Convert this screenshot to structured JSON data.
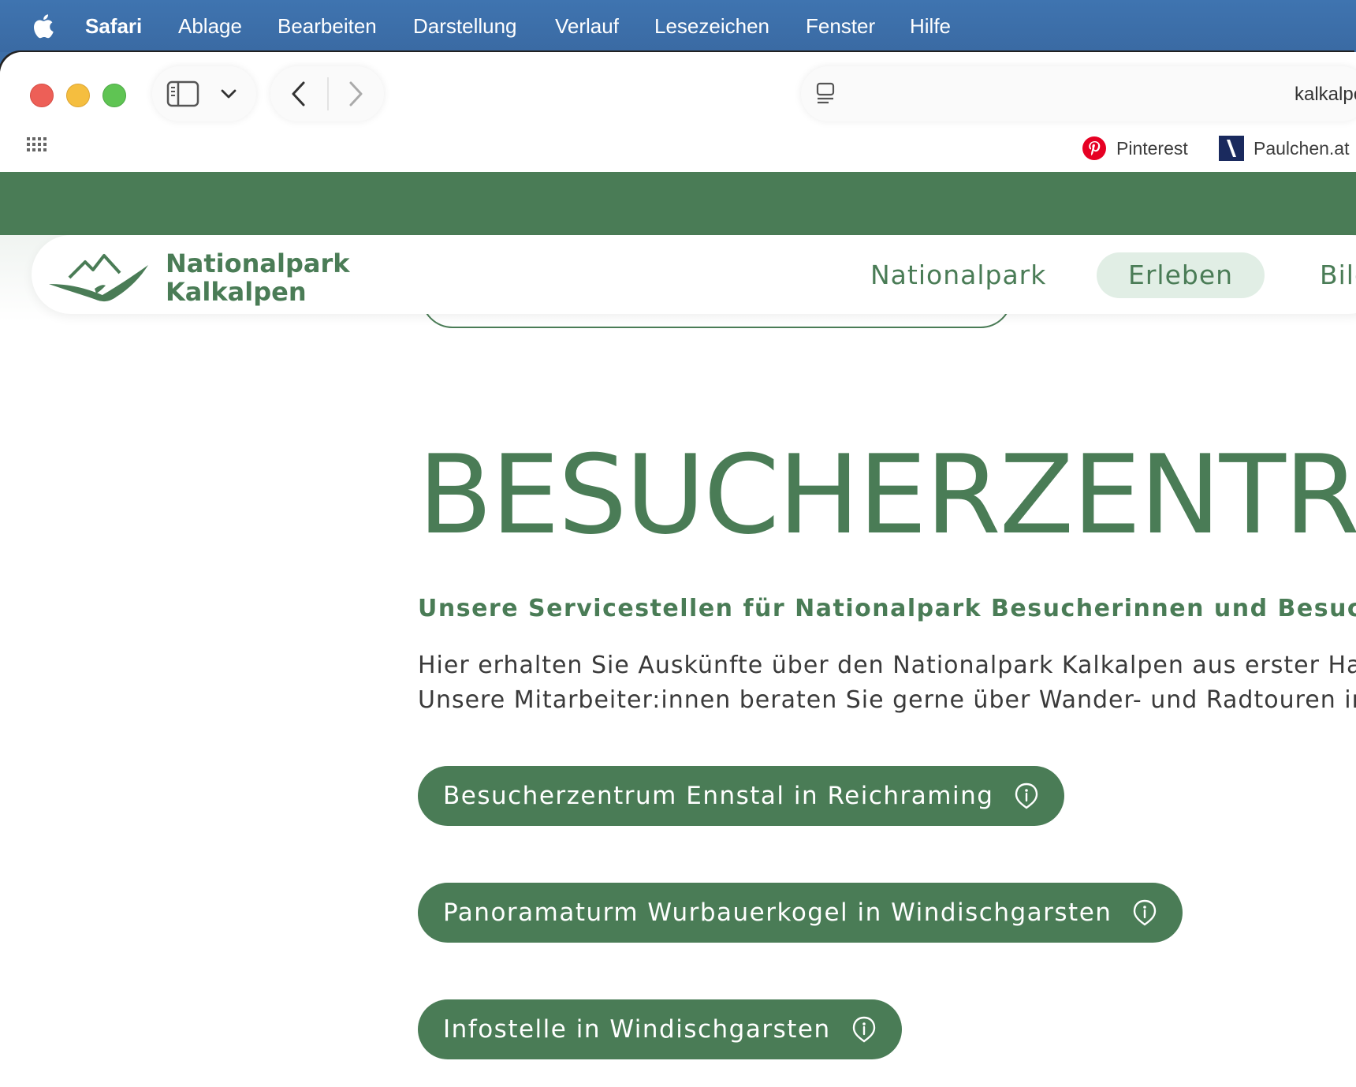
{
  "menubar": {
    "app": "Safari",
    "items": [
      "Ablage",
      "Bearbeiten",
      "Darstellung",
      "Verlauf",
      "Lesezeichen",
      "Fenster",
      "Hilfe"
    ]
  },
  "toolbar": {
    "url": "kalkalpen.at"
  },
  "bookmarks": [
    {
      "label": "Pinterest",
      "icon": "pinterest-icon",
      "color": "#e60023"
    },
    {
      "label": "Paulchen.at",
      "icon": "paulchen-icon",
      "color": "#1a2a5e"
    }
  ],
  "site": {
    "logo_line1": "Nationalpark",
    "logo_line2": "Kalkalpen",
    "nav": [
      "Nationalpark",
      "Erleben",
      "Bildung"
    ],
    "active_nav": "Erleben",
    "brand_color": "#4a7c56"
  },
  "content": {
    "title": "BESUCHERZENTREN",
    "subtitle": "Unsere Servicestellen für Nationalpark Besucherinnen und Besucher",
    "paragraph_line1": "Hier erhalten Sie Auskünfte über den Nationalpark Kalkalpen aus erster Hand.",
    "paragraph_line2": "Unsere Mitarbeiter:innen beraten Sie gerne über Wander- und Radtouren im Nationalpark",
    "buttons": [
      "Besucherzentrum Ennstal in Reichraming",
      "Panoramaturm Wurbauerkogel in Windischgarsten",
      "Infostelle in Windischgarsten"
    ]
  }
}
